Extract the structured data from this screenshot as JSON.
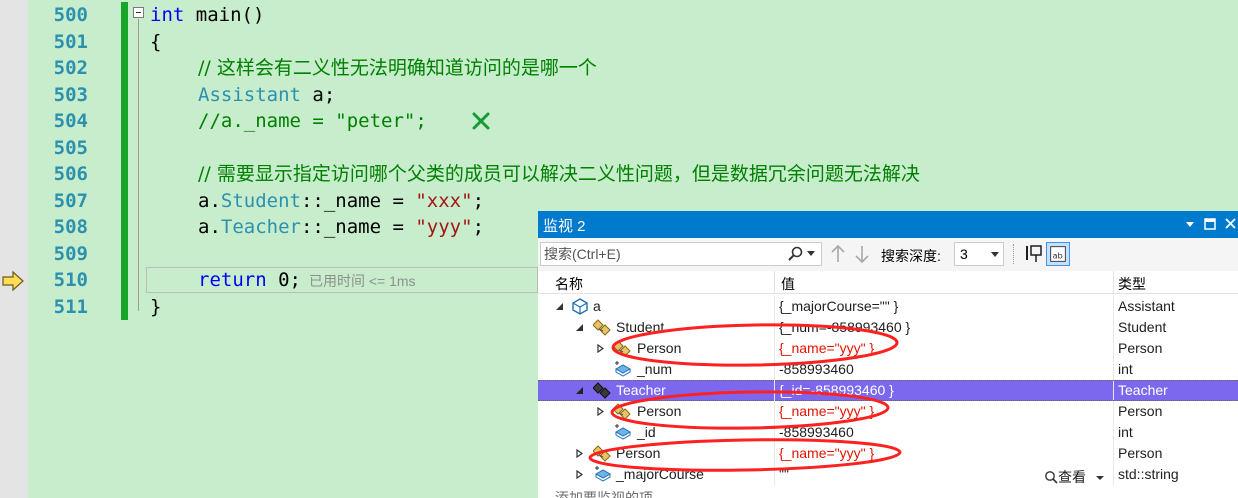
{
  "editor": {
    "line_numbers": [
      "500",
      "501",
      "502",
      "503",
      "504",
      "505",
      "506",
      "507",
      "508",
      "509",
      "510",
      "511"
    ],
    "lines": {
      "l500": {
        "kw": "int",
        "rest": " main()"
      },
      "l501": {
        "text": "{"
      },
      "l502": {
        "comment": "// 这样会有二义性无法明确知道访问的是哪一个"
      },
      "l503": {
        "type": "Assistant",
        "rest": " a;"
      },
      "l504": {
        "comment": "//a._name = \"peter\";"
      },
      "l506": {
        "comment": "// 需要显示指定访问哪个父类的成员可以解决二义性问题，但是数据冗余问题无法解决"
      },
      "l507": {
        "obj": "a.",
        "type": "Student",
        "mid": "::_name = ",
        "str": "\"xxx\"",
        "end": ";"
      },
      "l508": {
        "obj": "a.",
        "type": "Teacher",
        "mid": "::_name = ",
        "str": "\"yyy\"",
        "end": ";"
      },
      "l510": {
        "kw": "return",
        "rest": " 0;",
        "perf": "已用时间 <= 1ms"
      },
      "l511": {
        "text": "}"
      }
    },
    "colors": {
      "background": "#c7edcc",
      "keyword": "#0000ff",
      "type": "#2b91af",
      "string": "#a31515",
      "comment": "#008000",
      "line_number": "#2b91af",
      "change_bar": "#17a52a"
    }
  },
  "watch": {
    "title": "监视 2",
    "search_placeholder": "搜索(Ctrl+E)",
    "depth_label": "搜索深度:",
    "depth_value": "3",
    "columns": {
      "name": "名称",
      "value": "值",
      "type": "类型"
    },
    "rows": [
      {
        "name": "a",
        "value": "{_majorCourse=\"\" }",
        "type": "Assistant",
        "icon": "object-icon",
        "expanded": true
      },
      {
        "name": "Student",
        "value": "{_num=-858993460 }",
        "type": "Student",
        "icon": "base-class-icon",
        "expanded": true
      },
      {
        "name": "Person",
        "value": "{_name=\"yyy\" }",
        "type": "Person",
        "icon": "base-class-icon",
        "expanded": false
      },
      {
        "name": "_num",
        "value": "-858993460",
        "type": "int",
        "icon": "field-icon"
      },
      {
        "name": "Teacher",
        "value": "{_id=-858993460 }",
        "type": "Teacher",
        "icon": "base-class-icon",
        "expanded": true,
        "selected": true
      },
      {
        "name": "Person",
        "value": "{_name=\"yyy\" }",
        "type": "Person",
        "icon": "base-class-icon",
        "expanded": false
      },
      {
        "name": "_id",
        "value": "-858993460",
        "type": "int",
        "icon": "field-icon"
      },
      {
        "name": "Person",
        "value": "{_name=\"yyy\" }",
        "type": "Person",
        "icon": "base-class-icon",
        "expanded": false
      },
      {
        "name": "_majorCourse",
        "value": "\"\"",
        "type": "std::string",
        "icon": "field-icon",
        "expanded": false
      }
    ],
    "view_label": "查看",
    "add_watch": "添加要监视的项",
    "colors": {
      "title_bar": "#007acc",
      "selected_row": "#7b68ee",
      "changed_value": "#e51400",
      "annotation": "#ff2020"
    }
  }
}
